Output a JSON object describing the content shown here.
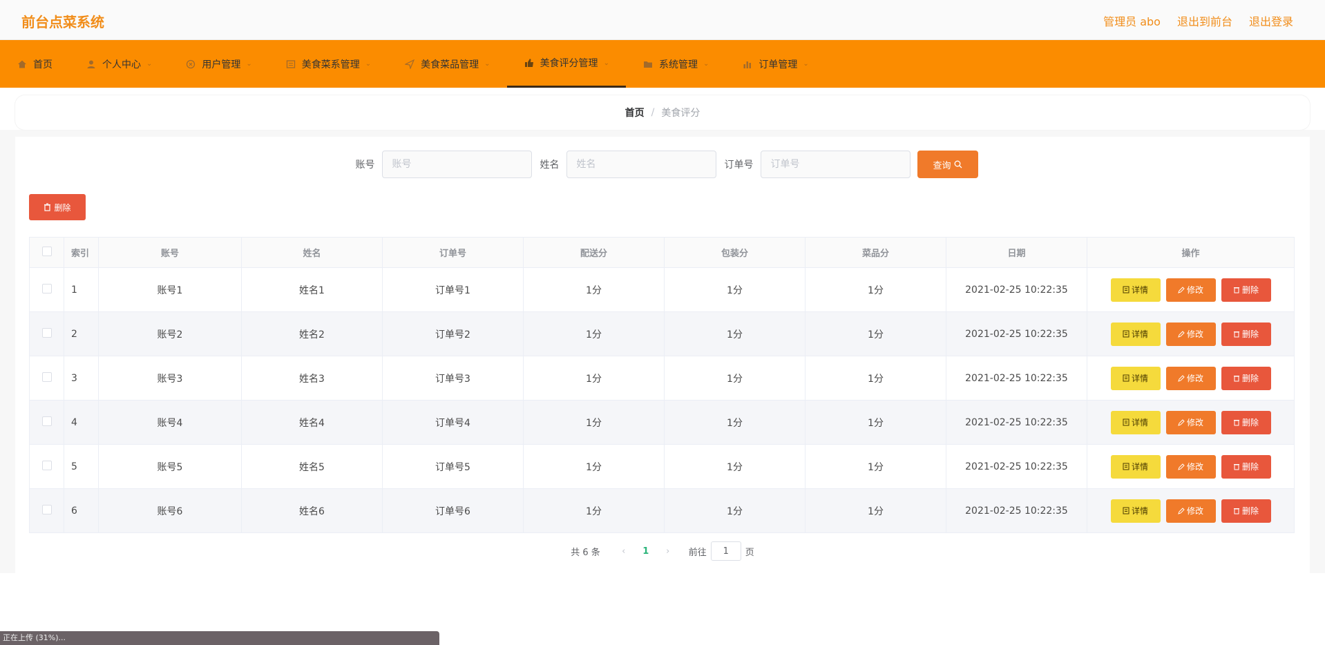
{
  "app": {
    "title": "前台点菜系统",
    "user_label": "管理员 abo",
    "back_front": "退出到前台",
    "logout": "退出登录"
  },
  "nav": [
    {
      "label": "首页",
      "icon": "home-icon",
      "caret": false
    },
    {
      "label": "个人中心",
      "icon": "user-icon",
      "caret": true
    },
    {
      "label": "用户管理",
      "icon": "circle-x-icon",
      "caret": true
    },
    {
      "label": "美食菜系管理",
      "icon": "document-icon",
      "caret": true
    },
    {
      "label": "美食菜品管理",
      "icon": "send-icon",
      "caret": true
    },
    {
      "label": "美食评分管理",
      "icon": "thumbs-up-icon",
      "caret": true,
      "active": true
    },
    {
      "label": "系统管理",
      "icon": "folder-icon",
      "caret": true
    },
    {
      "label": "订单管理",
      "icon": "bar-chart-icon",
      "caret": true
    }
  ],
  "breadcrumb": {
    "home": "首页",
    "sep": "/",
    "current": "美食评分"
  },
  "search": {
    "account_label": "账号",
    "account_placeholder": "账号",
    "name_label": "姓名",
    "name_placeholder": "姓名",
    "order_label": "订单号",
    "order_placeholder": "订单号",
    "query_label": "查询"
  },
  "delete_button": "删除",
  "table": {
    "headers": [
      "索引",
      "账号",
      "姓名",
      "订单号",
      "配送分",
      "包装分",
      "菜品分",
      "日期",
      "操作"
    ],
    "rows": [
      [
        "1",
        "账号1",
        "姓名1",
        "订单号1",
        "1分",
        "1分",
        "1分",
        "2021-02-25 10:22:35"
      ],
      [
        "2",
        "账号2",
        "姓名2",
        "订单号2",
        "1分",
        "1分",
        "1分",
        "2021-02-25 10:22:35"
      ],
      [
        "3",
        "账号3",
        "姓名3",
        "订单号3",
        "1分",
        "1分",
        "1分",
        "2021-02-25 10:22:35"
      ],
      [
        "4",
        "账号4",
        "姓名4",
        "订单号4",
        "1分",
        "1分",
        "1分",
        "2021-02-25 10:22:35"
      ],
      [
        "5",
        "账号5",
        "姓名5",
        "订单号5",
        "1分",
        "1分",
        "1分",
        "2021-02-25 10:22:35"
      ],
      [
        "6",
        "账号6",
        "姓名6",
        "订单号6",
        "1分",
        "1分",
        "1分",
        "2021-02-25 10:22:35"
      ]
    ],
    "op_detail": "详情",
    "op_edit": "修改",
    "op_remove": "删除"
  },
  "pager": {
    "total": "共 6 条",
    "current_page": "1",
    "goto_prefix": "前往",
    "goto_value": "1",
    "goto_suffix": "页"
  },
  "status_bar": "正在上传 (31%)...",
  "colors": {
    "nav_bg": "#fb8c00",
    "brand": "#f18d1a",
    "detail": "#f5da3c",
    "edit": "#f07a2a",
    "remove": "#e8573c"
  }
}
